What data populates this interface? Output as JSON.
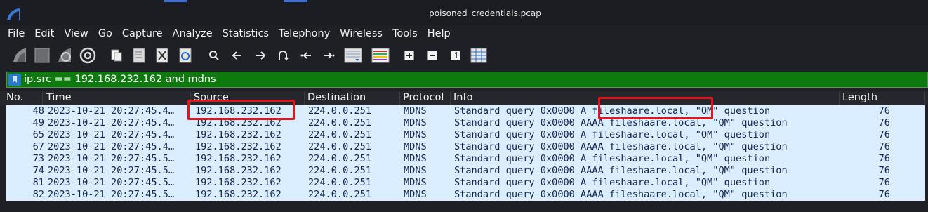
{
  "window": {
    "title": "poisoned_credentials.pcap"
  },
  "menu": [
    "File",
    "Edit",
    "View",
    "Go",
    "Capture",
    "Analyze",
    "Statistics",
    "Telephony",
    "Wireless",
    "Tools",
    "Help"
  ],
  "toolbar": {
    "icons": [
      "shark-fin-icon",
      "stop-capture-icon",
      "restart-capture-icon",
      "capture-options-icon",
      "open-file-icon",
      "save-file-icon",
      "close-file-icon",
      "reload-file-icon",
      "search-icon",
      "go-back-icon",
      "go-forward-icon",
      "go-to-packet-icon",
      "first-packet-icon",
      "last-packet-icon",
      "auto-scroll-icon",
      "colorize-icon",
      "zoom-in-icon",
      "zoom-out-icon",
      "normal-size-icon",
      "resize-columns-icon"
    ]
  },
  "filter": {
    "text": "ip.src == 192.168.232.162 and mdns",
    "color": "#0e7a0e"
  },
  "columns": {
    "no": "No.",
    "time": "Time",
    "source": "Source",
    "destination": "Destination",
    "protocol": "Protocol",
    "info": "Info",
    "length": "Length"
  },
  "packets": [
    {
      "no": "48",
      "time": "2023-10-21 20:27:45.4…",
      "source": "192.168.232.162",
      "destination": "224.0.0.251",
      "protocol": "MDNS",
      "info": "Standard query 0x0000 A fileshaare.local, \"QM\" question",
      "length": "76"
    },
    {
      "no": "49",
      "time": "2023-10-21 20:27:45.4…",
      "source": "192.168.232.162",
      "destination": "224.0.0.251",
      "protocol": "MDNS",
      "info": "Standard query 0x0000 AAAA fileshaare.local, \"QM\" question",
      "length": "76"
    },
    {
      "no": "65",
      "time": "2023-10-21 20:27:45.4…",
      "source": "192.168.232.162",
      "destination": "224.0.0.251",
      "protocol": "MDNS",
      "info": "Standard query 0x0000 A fileshaare.local, \"QM\" question",
      "length": "76"
    },
    {
      "no": "67",
      "time": "2023-10-21 20:27:45.4…",
      "source": "192.168.232.162",
      "destination": "224.0.0.251",
      "protocol": "MDNS",
      "info": "Standard query 0x0000 AAAA fileshaare.local, \"QM\" question",
      "length": "76"
    },
    {
      "no": "73",
      "time": "2023-10-21 20:27:45.5…",
      "source": "192.168.232.162",
      "destination": "224.0.0.251",
      "protocol": "MDNS",
      "info": "Standard query 0x0000 A fileshaare.local, \"QM\" question",
      "length": "76"
    },
    {
      "no": "74",
      "time": "2023-10-21 20:27:45.5…",
      "source": "192.168.232.162",
      "destination": "224.0.0.251",
      "protocol": "MDNS",
      "info": "Standard query 0x0000 AAAA fileshaare.local, \"QM\" question",
      "length": "76"
    },
    {
      "no": "81",
      "time": "2023-10-21 20:27:45.5…",
      "source": "192.168.232.162",
      "destination": "224.0.0.251",
      "protocol": "MDNS",
      "info": "Standard query 0x0000 A fileshaare.local, \"QM\" question",
      "length": "76"
    },
    {
      "no": "82",
      "time": "2023-10-21 20:27:45.5…",
      "source": "192.168.232.162",
      "destination": "224.0.0.251",
      "protocol": "MDNS",
      "info": "Standard query 0x0000 AAAA fileshaare.local, \"QM\" question",
      "length": "76"
    }
  ],
  "colors": {
    "row_background": "#daeeff",
    "row_text": "#12274a",
    "highlight_box": "#e8121b"
  }
}
